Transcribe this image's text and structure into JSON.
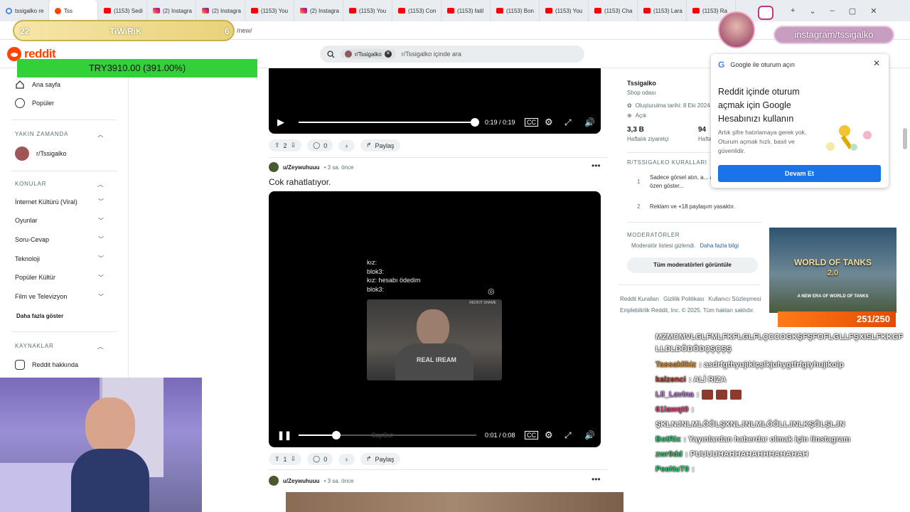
{
  "browser": {
    "tabs": [
      {
        "label": "tssigalko re",
        "icon": "google"
      },
      {
        "label": "Tss",
        "icon": "reddit",
        "active": true
      },
      {
        "label": "(1153) Sedi",
        "icon": "youtube"
      },
      {
        "label": "(2) Instagra",
        "icon": "instagram"
      },
      {
        "label": "(2) Instagra",
        "icon": "instagram"
      },
      {
        "label": "(1153) You",
        "icon": "youtube"
      },
      {
        "label": "(2) Instagra",
        "icon": "instagram"
      },
      {
        "label": "(1153) You",
        "icon": "youtube"
      },
      {
        "label": "(1153) Con",
        "icon": "youtube"
      },
      {
        "label": "(1153) fatil",
        "icon": "youtube"
      },
      {
        "label": "(1153) Bon",
        "icon": "youtube"
      },
      {
        "label": "(1153) You",
        "icon": "youtube"
      },
      {
        "label": "(1153) Cha",
        "icon": "youtube"
      },
      {
        "label": "(1153) Lara",
        "icon": "youtube"
      },
      {
        "label": "(1153) Ra",
        "icon": "youtube"
      }
    ],
    "url_fragment": "/new/"
  },
  "reddit": {
    "logo_text": "reddit",
    "search": {
      "chip": "r/Tssigalko",
      "placeholder": "r/Tssigalko içinde ara"
    },
    "leftnav": {
      "home": "Ana sayfa",
      "popular": "Popüler",
      "recent_header": "YAKIN ZAMANDA",
      "recent_item": "r/Tssigalko",
      "topics_header": "KONULAR",
      "topics": [
        "İnternet Kültürü (Viral)",
        "Oyunlar",
        "Soru-Cevap",
        "Teknoloji",
        "Popüler Kültür",
        "Film ve Televizyon"
      ],
      "more": "Daha fazla göster",
      "resources_header": "KAYNAKLAR",
      "about": "Reddit hakkında"
    },
    "post1": {
      "time": "0:19 / 0:19",
      "votes": "2",
      "comments": "0",
      "share": "Paylaş",
      "progress": 1.0
    },
    "post2": {
      "user": "u/Zeywuhuuu",
      "age": "• 3 sa. önce",
      "title": "Cok rahatlatıyor.",
      "overlay_lines": [
        "kız:",
        "blok3:",
        "kız: hesabı ödedim",
        "blok3:"
      ],
      "watermark": "CapCut",
      "tag": "REDDIT SHAME",
      "shirt": "REAL IREAM",
      "time": "0:01 / 0:08",
      "progress": 0.21,
      "votes": "1",
      "comments": "0",
      "share": "Paylaş"
    },
    "post3": {
      "user": "u/Zeywuhuuu",
      "age": "• 3 sa. önce"
    },
    "sidebar": {
      "name": "Tssigalko",
      "subtitle": "Shop odası",
      "created": "Oluşturulma tarihi: 8 Eki 2024",
      "visibility": "Açık",
      "stat1_value": "3,3 B",
      "stat1_label": "Haftalık ziyaretçi",
      "stat2_value": "94",
      "stat2_label": "Haftalık",
      "rules_header": "R/TSSIGALKO KURALLARI",
      "rule1_num": "1",
      "rule1": "Sadece görsel atın, a... atmamaya özen göster...",
      "rule2_num": "2",
      "rule2": "Reklam ve +18 paylaşım yasaktır.",
      "mods_header": "MODERATÖRLER",
      "mods_hidden": "Moderatör listesi gizlendi.",
      "mods_more": "Daha fazla bilgi",
      "mods_button": "Tüm moderatörleri görüntüle",
      "footer_links": [
        "Reddit Kuralları",
        "Gizlilik Politikası",
        "Kullanıcı Sözleşmesi"
      ],
      "footer2": "Erişilebilirlik  Reddit, Inc. © 2025. Tüm hakları saklıdır."
    },
    "google_popup": {
      "header": "Google ile oturum açın",
      "title": "Reddit içinde oturum açmak için Google Hesabınızı kullanın",
      "body": "Artık şifre hatırlamaya gerek yok. Oturum açmak hızlı, basit ve güvenlidir.",
      "button": "Devam Et"
    }
  },
  "stream": {
    "bar_left": "22",
    "bar_title": "TiWiRiK",
    "bar_right": "6",
    "money": "TRY3910.00 (391.00%)",
    "instagram": "instagram/tssigalko",
    "ad_title": "WORLD OF TANKS",
    "ad_version": "2.0",
    "ad_tagline": "A NEW ERA OF WORLD OF TANKS",
    "goal": "251/250",
    "chat": [
      {
        "user": "",
        "msg": "MZMCMVLGLFMLFKFLGLFLÇCCOGKŞFŞFOFLGLLFŞXISLFKKGF LLDLDÖDÖDÇŞÇŞŞ",
        "color": "#ffffff"
      },
      {
        "user": "Tassaklikiz",
        "msg": ": asdrfgthyujıklçşlkjuhygtfrfgtyhujıkolp",
        "color": "#d98a2b"
      },
      {
        "user": "kalzenci",
        "msg": ": ALİ RIZA",
        "color": "#c0392b"
      },
      {
        "user": "Lil_Lavina",
        "msg": ":",
        "color": "#b57bd1",
        "emotes": 3
      },
      {
        "user": "61lawqt0",
        "msg": ":",
        "color": "#e0407a"
      },
      {
        "user": "",
        "msg": "ŞKLNJNLMLÖÖLŞXNLJNLMLÖÖLLJNLKŞÖLŞLJN",
        "color": "#ffffff"
      },
      {
        "user": "BotRix",
        "msg": ": Yayınlardan haberdar olmak için !instagram",
        "color": "#2ecc71"
      },
      {
        "user": "zwr9dd",
        "msg": ": PUUUUHAHHAHAHHHAHAHAH",
        "color": "#3fbf6f"
      },
      {
        "user": "PeeNuT0",
        "msg": ":",
        "color": "#2ecc71"
      }
    ]
  }
}
